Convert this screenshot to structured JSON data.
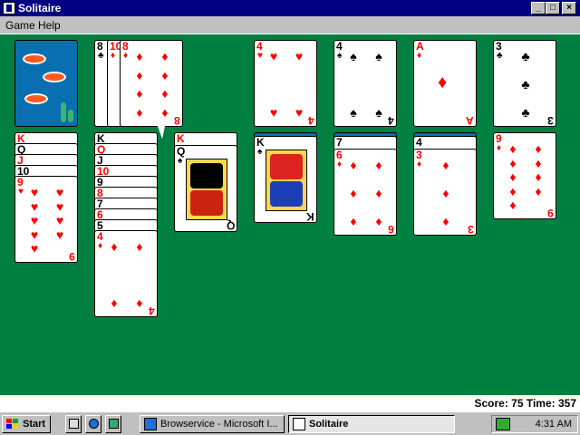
{
  "window": {
    "title": "Solitaire",
    "min_glyph": "_",
    "max_glyph": "□",
    "close_glyph": "×"
  },
  "menu": {
    "game": "Game",
    "help": "Help"
  },
  "colors": {
    "felt": "#008040",
    "title_bar": "#000080",
    "red_suit": "#ff0000",
    "card_back": "#0a6fb0"
  },
  "stock": {
    "state": "face-down",
    "back_design": "fish"
  },
  "waste": [
    {
      "rank": "8",
      "suit": "♣",
      "color": "black"
    },
    {
      "rank": "10",
      "suit": "♦",
      "color": "red"
    },
    {
      "rank": "8",
      "suit": "♦",
      "color": "red"
    }
  ],
  "foundations": [
    {
      "rank": "4",
      "suit": "♥",
      "color": "red"
    },
    {
      "rank": "4",
      "suit": "♠",
      "color": "black"
    },
    {
      "rank": "A",
      "suit": "♦",
      "color": "red"
    },
    {
      "rank": "3",
      "suit": "♣",
      "color": "black"
    }
  ],
  "tableau": [
    {
      "hidden": 0,
      "cards": [
        {
          "rank": "K",
          "suit": "♥",
          "color": "red"
        },
        {
          "rank": "Q",
          "suit": "♠",
          "color": "black"
        },
        {
          "rank": "J",
          "suit": "♥",
          "color": "red"
        },
        {
          "rank": "10",
          "suit": "♠",
          "color": "black"
        },
        {
          "rank": "9",
          "suit": "♥",
          "color": "red"
        }
      ]
    },
    {
      "hidden": 0,
      "cards": [
        {
          "rank": "K",
          "suit": "♠",
          "color": "black"
        },
        {
          "rank": "Q",
          "suit": "♥",
          "color": "red"
        },
        {
          "rank": "J",
          "suit": "♠",
          "color": "black"
        },
        {
          "rank": "10",
          "suit": "♥",
          "color": "red"
        },
        {
          "rank": "9",
          "suit": "♠",
          "color": "black"
        },
        {
          "rank": "8",
          "suit": "♥",
          "color": "red"
        },
        {
          "rank": "7",
          "suit": "♠",
          "color": "black"
        },
        {
          "rank": "6",
          "suit": "♥",
          "color": "red"
        },
        {
          "rank": "5",
          "suit": "♠",
          "color": "black"
        },
        {
          "rank": "4",
          "suit": "♦",
          "color": "red"
        }
      ]
    },
    {
      "hidden": 0,
      "cards": [
        {
          "rank": "K",
          "suit": "♥",
          "color": "red"
        },
        {
          "rank": "Q",
          "suit": "♠",
          "color": "black"
        }
      ]
    },
    {
      "hidden": 1,
      "cards": [
        {
          "rank": "K",
          "suit": "♠",
          "color": "black"
        }
      ]
    },
    {
      "hidden": 1,
      "cards": [
        {
          "rank": "7",
          "suit": "♠",
          "color": "black"
        },
        {
          "rank": "6",
          "suit": "♦",
          "color": "red"
        }
      ]
    },
    {
      "hidden": 1,
      "cards": [
        {
          "rank": "4",
          "suit": "♠",
          "color": "black"
        },
        {
          "rank": "3",
          "suit": "♦",
          "color": "red"
        }
      ]
    },
    {
      "hidden": 0,
      "cards": [
        {
          "rank": "9",
          "suit": "♦",
          "color": "red"
        }
      ]
    }
  ],
  "status": {
    "score_text": "Score: 75 Time: 357"
  },
  "taskbar": {
    "start_label": "Start",
    "tasks": [
      {
        "label": "Browservice - Microsoft I..."
      },
      {
        "label": "Solitaire"
      }
    ],
    "clock": "4:31 AM"
  }
}
